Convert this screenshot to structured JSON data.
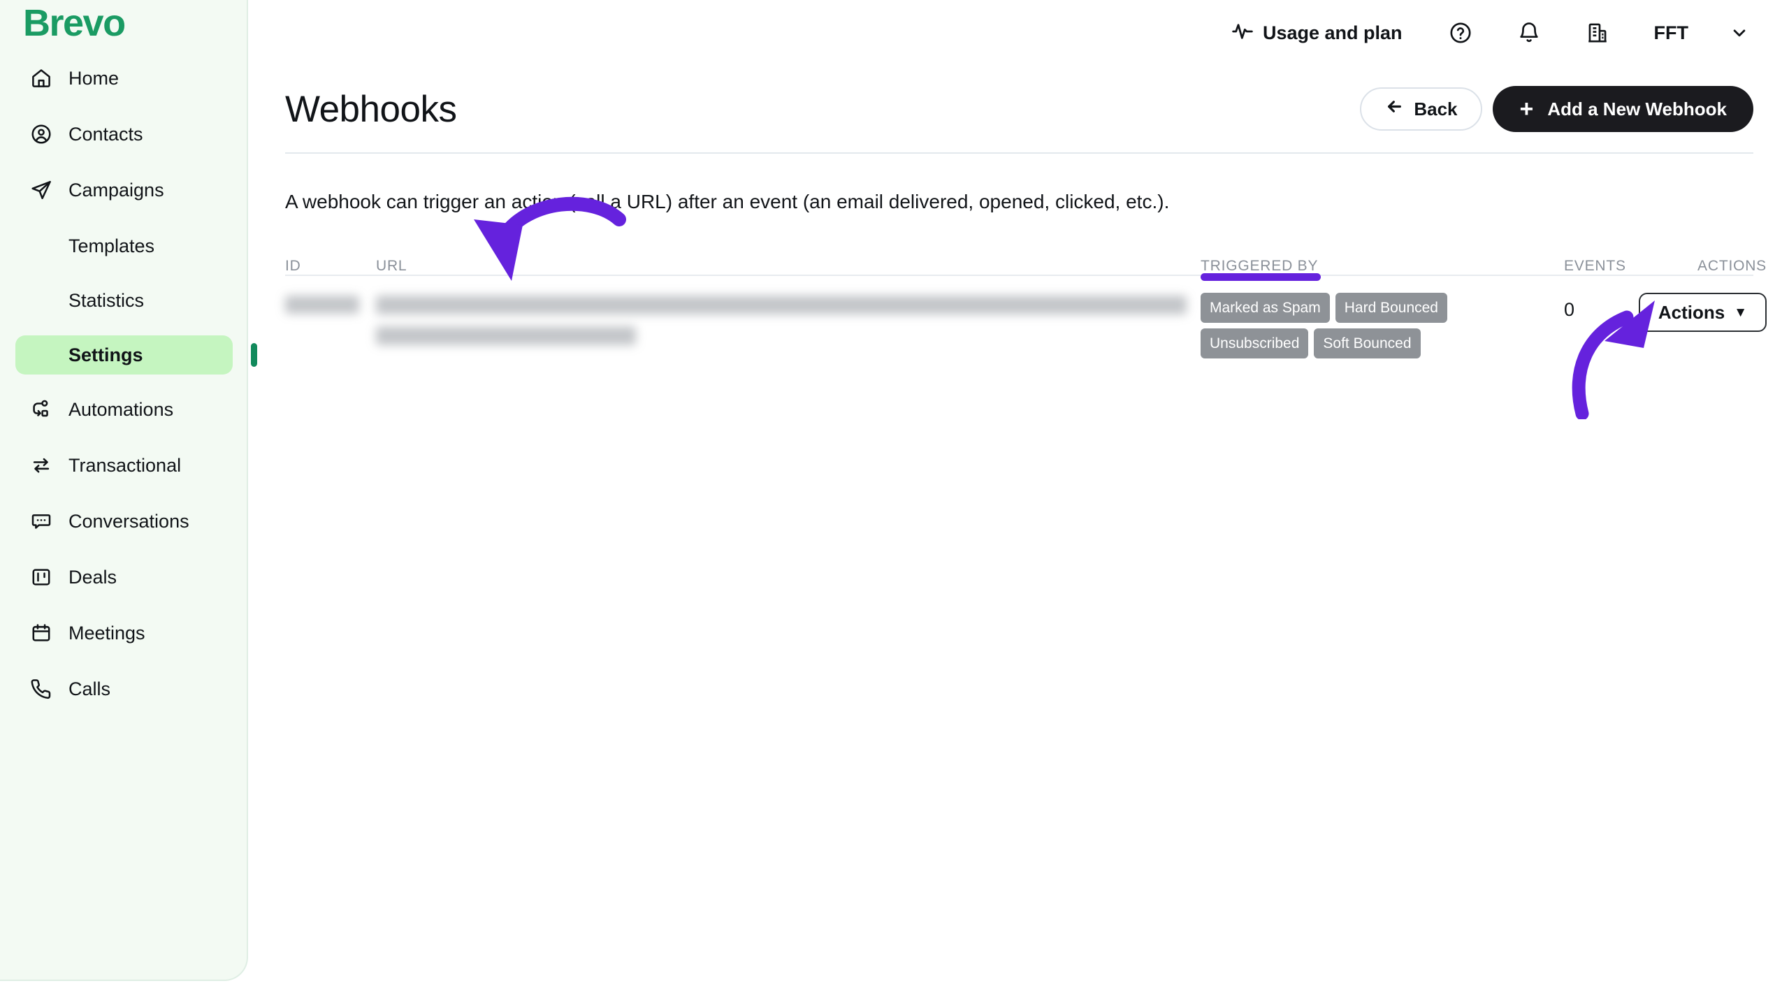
{
  "brand": {
    "name": "Brevo",
    "color": "#1a9b63"
  },
  "sidebar": {
    "items": [
      {
        "label": "Home",
        "icon": "home-icon",
        "sub": false,
        "active": false
      },
      {
        "label": "Contacts",
        "icon": "contacts-icon",
        "sub": false,
        "active": false
      },
      {
        "label": "Campaigns",
        "icon": "campaigns-icon",
        "sub": false,
        "active": false
      },
      {
        "label": "Templates",
        "icon": "",
        "sub": true,
        "active": false
      },
      {
        "label": "Statistics",
        "icon": "",
        "sub": true,
        "active": false
      },
      {
        "label": "Settings",
        "icon": "",
        "sub": true,
        "active": true
      },
      {
        "label": "Automations",
        "icon": "automations-icon",
        "sub": false,
        "active": false
      },
      {
        "label": "Transactional",
        "icon": "transactional-icon",
        "sub": false,
        "active": false
      },
      {
        "label": "Conversations",
        "icon": "conversations-icon",
        "sub": false,
        "active": false
      },
      {
        "label": "Deals",
        "icon": "deals-icon",
        "sub": false,
        "active": false
      },
      {
        "label": "Meetings",
        "icon": "meetings-icon",
        "sub": false,
        "active": false
      },
      {
        "label": "Calls",
        "icon": "calls-icon",
        "sub": false,
        "active": false
      }
    ],
    "active_accent": "#128a5c",
    "active_background": "#c5f5c0"
  },
  "header": {
    "usage_and_plan": "Usage and plan",
    "usage_icon": "activity-pulse-icon",
    "help_icon": "help-circle-icon",
    "notifications_icon": "bell-icon",
    "organization_icon": "building-icon",
    "org_name": "FFT",
    "caret_icon": "chevron-down-icon"
  },
  "main": {
    "page_title": "Webhooks",
    "back_label": "Back",
    "back_icon": "arrow-left-icon",
    "add_label": "Add a New Webhook",
    "add_icon": "plus-icon",
    "description": "A webhook can trigger an action (call a URL) after an event (an email delivered, opened, clicked, etc.)."
  },
  "table": {
    "columns": [
      "ID",
      "URL",
      "TRIGGERED BY",
      "EVENTS",
      "ACTIONS"
    ],
    "highlight_column": "TRIGGERED BY",
    "highlight_color": "#6522dd",
    "rows": [
      {
        "id": "",
        "url": "",
        "id_redacted": true,
        "url_redacted": true,
        "triggered_by": [
          "Marked as Spam",
          "Hard Bounced",
          "Unsubscribed",
          "Soft Bounced"
        ],
        "events": "0",
        "actions_label": "Actions",
        "actions_caret": "caret-down-icon"
      }
    ]
  },
  "annotations": {
    "color": "#6522dd",
    "arrows": [
      {
        "name": "arrow-to-url-column",
        "points_to": "URL column"
      },
      {
        "name": "arrow-to-actions-button",
        "points_to": "Actions button"
      }
    ]
  }
}
